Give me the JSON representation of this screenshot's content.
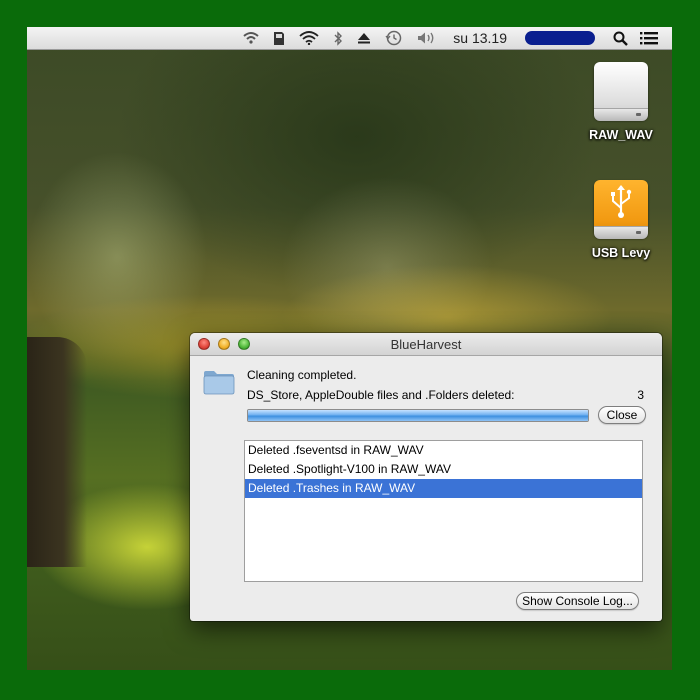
{
  "menubar": {
    "icons": [
      "wifi-alt-icon",
      "sd-card-icon",
      "wifi-icon",
      "bluetooth-icon",
      "eject-icon",
      "time-machine-icon",
      "volume-icon",
      "spotlight-icon",
      "notification-center-icon"
    ],
    "clock": "su 13.19"
  },
  "desktop": {
    "items": [
      {
        "label": "RAW_WAV",
        "color": "#ffffff"
      },
      {
        "label": "USB Levy",
        "color": "#f29a12"
      }
    ]
  },
  "window": {
    "title": "BlueHarvest",
    "status": "Cleaning completed.",
    "summary_label": "DS_Store, AppleDouble files and .Folders deleted:",
    "summary_count": "3",
    "progress": 1.0,
    "close_label": "Close",
    "log": [
      {
        "text": "Deleted .fseventsd in RAW_WAV",
        "selected": false
      },
      {
        "text": "Deleted .Spotlight-V100 in RAW_WAV",
        "selected": false
      },
      {
        "text": "Deleted .Trashes in RAW_WAV",
        "selected": true
      }
    ],
    "console_label": "Show Console Log..."
  },
  "colors": {
    "frame": "#0a6b0a",
    "selection": "#3b73d6",
    "user_redaction": "#0a1f8f"
  }
}
